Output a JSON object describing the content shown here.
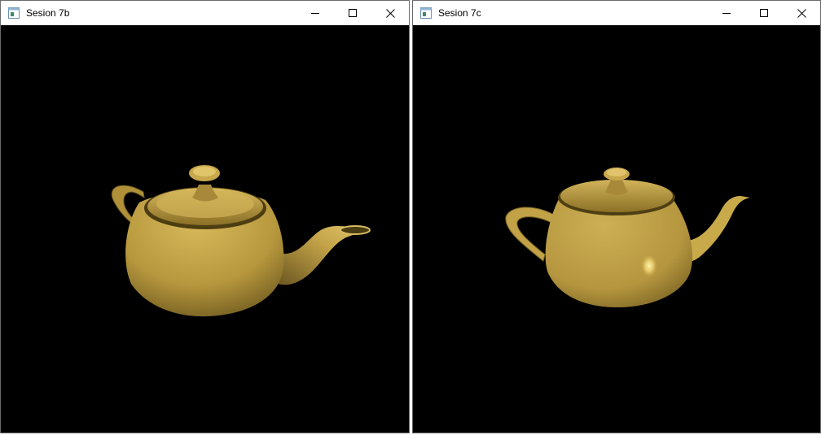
{
  "windows": [
    {
      "title": "Sesion 7b",
      "icon": "app-window-icon",
      "controls": [
        "minimize-icon",
        "maximize-icon",
        "close-icon"
      ]
    },
    {
      "title": "Sesion 7c",
      "icon": "app-window-icon",
      "controls": [
        "minimize-icon",
        "maximize-icon",
        "close-icon"
      ]
    }
  ],
  "colors": {
    "background": "#000000",
    "teapot_base": "#c9a94a",
    "teapot_shadow": "#5e4c18",
    "teapot_highlight": "#fff2a8"
  }
}
